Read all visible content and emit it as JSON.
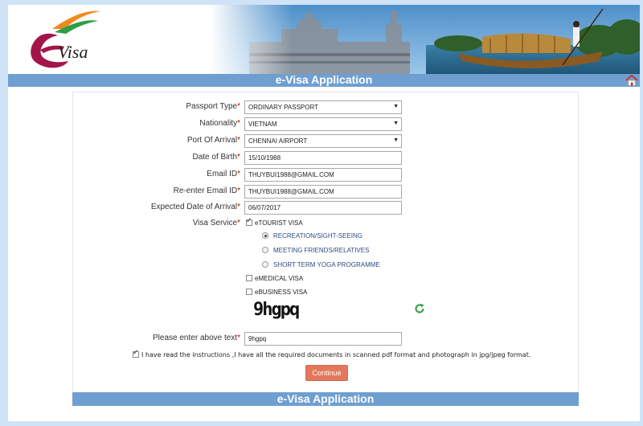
{
  "header": {
    "logo_text": "Visa",
    "title": "e-Visa Application"
  },
  "colors": {
    "page_bg": "#cfe3f6",
    "title_bar": "#6f9fd1",
    "continue_button": "#e3785d",
    "required_mark": "#cc0000",
    "sub_option_text": "#2e4c80",
    "refresh_icon": "#3aa14a"
  },
  "icons": {
    "home": "home-icon",
    "refresh": "refresh-icon"
  },
  "form": {
    "passport_type": {
      "label": "Passport Type",
      "value": "ORDINARY PASSPORT"
    },
    "nationality": {
      "label": "Nationality",
      "value": "VIETNAM"
    },
    "port_of_arrival": {
      "label": "Port Of Arrival",
      "value": "CHENNAI AIRPORT"
    },
    "date_of_birth": {
      "label": "Date of Birth",
      "value": "15/10/1988"
    },
    "email": {
      "label": "Email ID",
      "value": "THUYBUI1988@GMAIL.COM"
    },
    "email_confirm": {
      "label": "Re-enter Email ID",
      "value": "THUYBUI1988@GMAIL.COM"
    },
    "arrival_date": {
      "label": "Expected Date of Arrival",
      "value": "06/07/2017"
    },
    "visa_service": {
      "label": "Visa Service",
      "etourist": {
        "label": "eTOURIST VISA",
        "checked": true
      },
      "tourist_options": [
        {
          "label": "RECREATION/SIGHT-SEEING",
          "selected": true
        },
        {
          "label": "MEETING FRIENDS/RELATIVES",
          "selected": false
        },
        {
          "label": "SHORT TERM YOGA PROGRAMME",
          "selected": false
        }
      ],
      "emedical": {
        "label": "eMEDICAL VISA",
        "checked": false
      },
      "ebusiness": {
        "label": "eBUSINESS VISA",
        "checked": false
      }
    },
    "captcha": {
      "image_text": "9hgpq",
      "label": "Please enter above text",
      "value": "9hgpq"
    },
    "agreement": {
      "text": "I have read the instructions ,I have all the required documents in scanned pdf format and photograph in jpg/jpeg format.",
      "checked": true
    },
    "required_mark": "*",
    "continue_label": "Continue"
  },
  "footer": {
    "title": "e-Visa Application"
  }
}
